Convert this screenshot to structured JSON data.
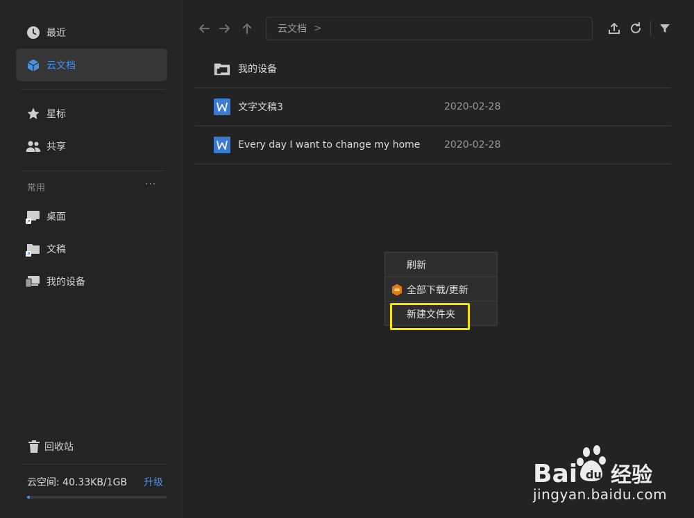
{
  "sidebar": {
    "items": [
      {
        "label": "最近",
        "icon": "clock-icon"
      },
      {
        "label": "云文档",
        "icon": "cube-icon",
        "active": true
      },
      {
        "label": "星标",
        "icon": "star-icon"
      },
      {
        "label": "共享",
        "icon": "people-icon"
      }
    ],
    "section_title": "常用",
    "section_more": "···",
    "favorites": [
      {
        "label": "桌面",
        "icon": "desktop-shortcut-icon"
      },
      {
        "label": "文稿",
        "icon": "folder-shortcut-icon"
      },
      {
        "label": "我的设备",
        "icon": "devices-icon"
      }
    ],
    "trash_label": "回收站",
    "storage": {
      "text": "云空间: 40.33KB/1GB",
      "upgrade": "升级",
      "used_fraction": 0.02
    }
  },
  "toolbar": {
    "breadcrumb": "云文档",
    "breadcrumb_sep": ">"
  },
  "files": [
    {
      "name": "我的设备",
      "type": "device-folder",
      "date": ""
    },
    {
      "name": "文字文稿3",
      "type": "wps-doc",
      "date": "2020-02-28"
    },
    {
      "name": "Every day I want to change my home",
      "type": "wps-doc",
      "date": "2020-02-28"
    }
  ],
  "context_menu": {
    "items": [
      {
        "label": "刷新"
      },
      {
        "label": "全部下载/更新",
        "icon": "crown-badge-icon"
      },
      {
        "label": "新建文件夹",
        "highlighted": true
      }
    ]
  },
  "watermark": {
    "text": "jingyan.baidu.com",
    "brand": "Bai经验"
  },
  "colors": {
    "accent": "#4a90e2",
    "highlight": "#f7e500",
    "background": "#232323"
  }
}
